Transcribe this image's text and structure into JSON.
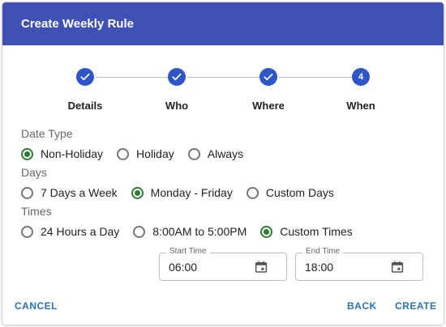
{
  "dialog": {
    "title": "Create Weekly Rule"
  },
  "stepper": {
    "steps": [
      {
        "label": "Details",
        "status": "complete",
        "icon": "check-icon"
      },
      {
        "label": "Who",
        "status": "complete",
        "icon": "check-icon"
      },
      {
        "label": "Where",
        "status": "complete",
        "icon": "check-icon"
      },
      {
        "label": "When",
        "status": "active",
        "number": "4"
      }
    ]
  },
  "date_type": {
    "label": "Date Type",
    "options": [
      "Non-Holiday",
      "Holiday",
      "Always"
    ],
    "selected": "Non-Holiday"
  },
  "days": {
    "label": "Days",
    "options": [
      "7 Days a Week",
      "Monday - Friday",
      "Custom Days"
    ],
    "selected": "Monday - Friday"
  },
  "times": {
    "label": "Times",
    "options": [
      "24 Hours a Day",
      "8:00AM to 5:00PM",
      "Custom Times"
    ],
    "selected": "Custom Times"
  },
  "start_time": {
    "label": "Start Time",
    "value": "06:00",
    "icon": "calendar-icon"
  },
  "end_time": {
    "label": "End Time",
    "value": "18:00",
    "icon": "calendar-icon"
  },
  "actions": {
    "cancel": "CANCEL",
    "back": "BACK",
    "create": "CREATE"
  },
  "colors": {
    "header_bg": "#3f51b5",
    "step_circle": "#2f56c8",
    "radio_checked": "#2e7d32",
    "button_text": "#2a73b8"
  }
}
